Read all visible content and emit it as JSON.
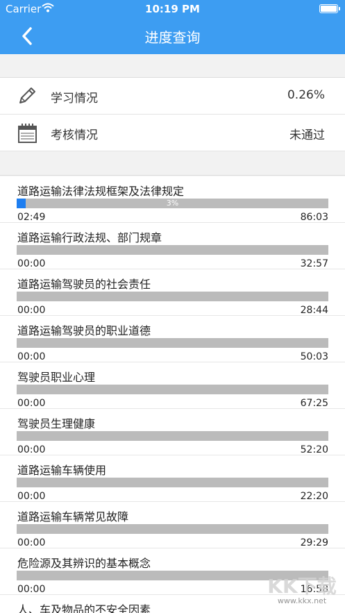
{
  "status_bar": {
    "carrier": "Carrier",
    "time": "10:19 PM"
  },
  "nav": {
    "title": "进度查询",
    "back_icon": "chevron-left-icon"
  },
  "summary": [
    {
      "icon": "pencil-icon",
      "label": "学习情况",
      "value": "0.26%"
    },
    {
      "icon": "calendar-icon",
      "label": "考核情况",
      "value": "未通过"
    }
  ],
  "courses": [
    {
      "name": "道路运输法律法规框架及法律规定",
      "progress": 0.03,
      "progress_label": "3%",
      "elapsed": "02:49",
      "total": "86:03"
    },
    {
      "name": "道路运输行政法规、部门规章",
      "progress": 0,
      "progress_label": "",
      "elapsed": "00:00",
      "total": "32:57"
    },
    {
      "name": "道路运输驾驶员的社会责任",
      "progress": 0,
      "progress_label": "",
      "elapsed": "00:00",
      "total": "28:44"
    },
    {
      "name": "道路运输驾驶员的职业道德",
      "progress": 0,
      "progress_label": "",
      "elapsed": "00:00",
      "total": "50:03"
    },
    {
      "name": "驾驶员职业心理",
      "progress": 0,
      "progress_label": "",
      "elapsed": "00:00",
      "total": "67:25"
    },
    {
      "name": "驾驶员生理健康",
      "progress": 0,
      "progress_label": "",
      "elapsed": "00:00",
      "total": "52:20"
    },
    {
      "name": "道路运输车辆使用",
      "progress": 0,
      "progress_label": "",
      "elapsed": "00:00",
      "total": "22:20"
    },
    {
      "name": "道路运输车辆常见故障",
      "progress": 0,
      "progress_label": "",
      "elapsed": "00:00",
      "total": "29:29"
    },
    {
      "name": "危险源及其辨识的基本概念",
      "progress": 0,
      "progress_label": "",
      "elapsed": "00:00",
      "total": "16:58"
    },
    {
      "name": "人、车及物品的不安全因素",
      "progress": 0,
      "progress_label": "",
      "elapsed": "",
      "total": ""
    }
  ],
  "watermark": {
    "text": "KK下载",
    "url": "www.kkx.net"
  },
  "colors": {
    "header": "#3d9df2",
    "progress_fill": "#1e7ef0",
    "progress_track": "#bbbbbb"
  }
}
